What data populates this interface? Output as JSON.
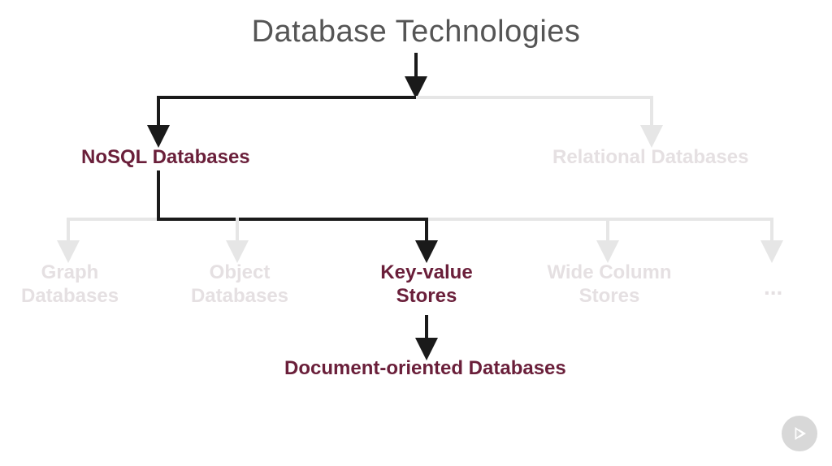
{
  "title": "Database Technologies",
  "level2": {
    "nosql": "NoSQL Databases",
    "relational": "Relational Databases"
  },
  "level3": {
    "graph": "Graph\nDatabases",
    "object": "Object\nDatabases",
    "keyvalue": "Key-value\nStores",
    "widecolumn": "Wide Column\nStores",
    "more": "..."
  },
  "level4": {
    "document": "Document-oriented Databases"
  },
  "colors": {
    "active_text": "#6a1f3a",
    "faded_text": "#e5e0e2",
    "title_text": "#555555",
    "arrow_dark": "#1a1a1a",
    "arrow_light": "#e6e6e6"
  }
}
